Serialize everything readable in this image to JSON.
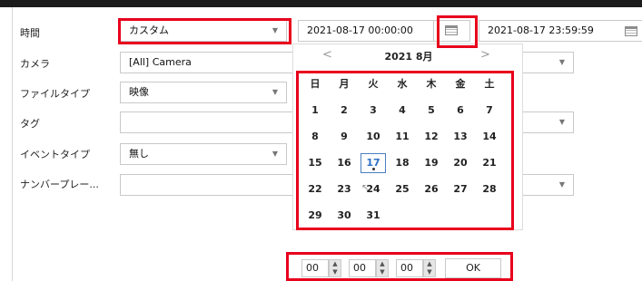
{
  "form": {
    "time_label": "時間",
    "camera_label": "カメラ",
    "filetype_label": "ファイルタイプ",
    "tag_label": "タグ",
    "eventtype_label": "イベントタイプ",
    "plate_label": "ナンバープレー...",
    "time_value": "カスタム",
    "camera_value": "[All] Camera",
    "filetype_value": "映像",
    "tag_value": "",
    "eventtype_value": "無し",
    "plate_value": "",
    "start_datetime": "2021-08-17 00:00:00",
    "end_datetime": "2021-08-17 23:59:59"
  },
  "calendar": {
    "month_title": "2021 8月",
    "prev": "<",
    "next": ">",
    "weekdays": [
      "日",
      "月",
      "火",
      "水",
      "木",
      "金",
      "土"
    ],
    "days": [
      "1",
      "2",
      "3",
      "4",
      "5",
      "6",
      "7",
      "8",
      "9",
      "10",
      "11",
      "12",
      "13",
      "14",
      "15",
      "16",
      "17",
      "18",
      "19",
      "20",
      "21",
      "22",
      "23",
      "24",
      "25",
      "26",
      "27",
      "28",
      "29",
      "30",
      "31"
    ],
    "selected_day": "17"
  },
  "time_picker": {
    "hour": "00",
    "minute": "00",
    "second": "00",
    "ok_label": "OK"
  },
  "colors": {
    "highlight": "#e8001c",
    "selected_day": "#2d6fc4"
  }
}
